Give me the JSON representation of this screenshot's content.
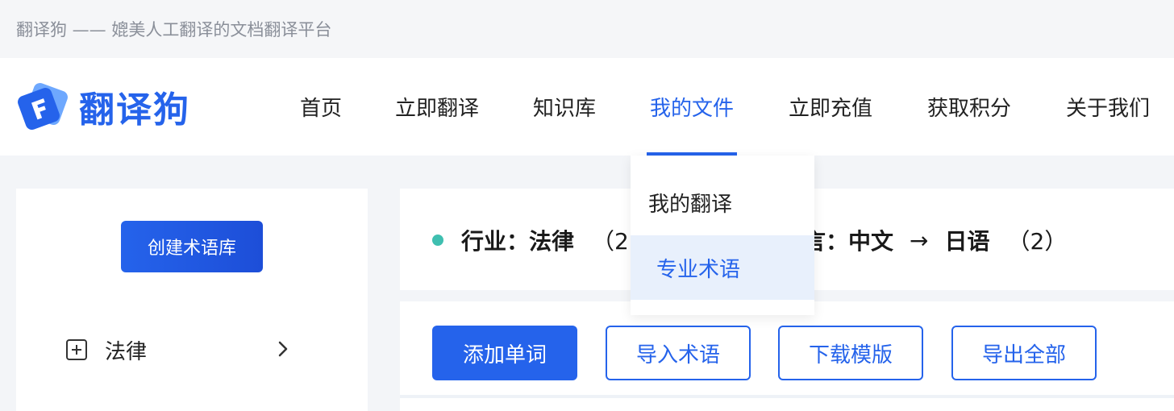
{
  "window": {
    "title": "翻译狗 —— 媲美人工翻译的文档翻译平台"
  },
  "header": {
    "logo_text": "翻译狗",
    "brand_color": "#2563eb",
    "nav": [
      {
        "label": "首页"
      },
      {
        "label": "立即翻译"
      },
      {
        "label": "知识库"
      },
      {
        "label": "我的文件",
        "active": true
      },
      {
        "label": "立即充值"
      },
      {
        "label": "获取积分"
      },
      {
        "label": "关于我们"
      }
    ]
  },
  "dropdown": {
    "items": [
      {
        "label": "我的翻译"
      },
      {
        "label": "专业术语",
        "active": true
      }
    ]
  },
  "sidebar": {
    "create_button": "创建术语库",
    "items": [
      {
        "label": "法律",
        "icon": "plus-square-icon"
      }
    ]
  },
  "info": {
    "industry_label": "行业：",
    "industry_value": "法律",
    "industry_count_visible": "（2",
    "language_label_visible": "言：",
    "source_lang": "中文",
    "arrow": "→",
    "target_lang": "日语",
    "language_count": "（2）",
    "dot_color": "#3fbfb0"
  },
  "actions": {
    "add_word": "添加单词",
    "import_terms": "导入术语",
    "download_template": "下载模版",
    "export_all": "导出全部"
  }
}
